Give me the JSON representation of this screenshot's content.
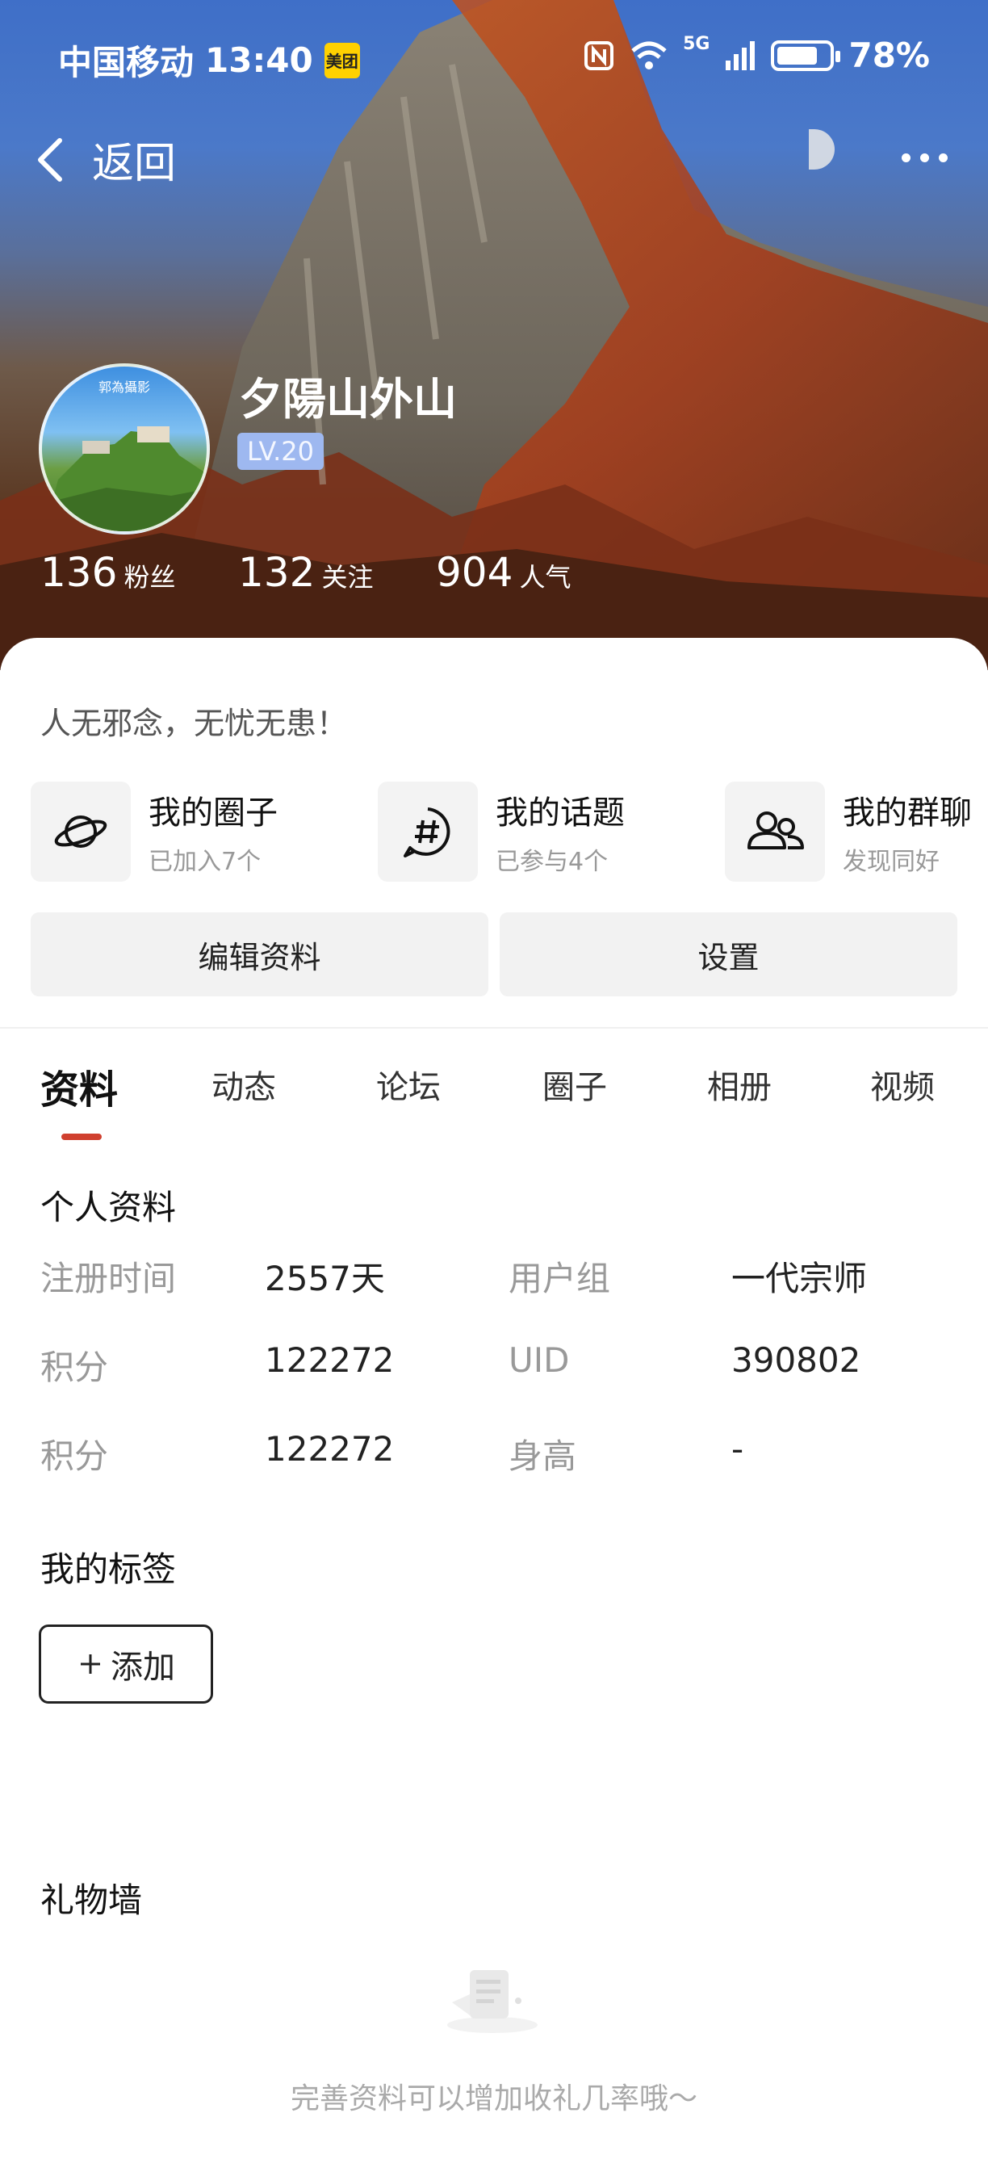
{
  "status_bar": {
    "carrier": "中国移动",
    "time": "13:40",
    "app_badge": "美团",
    "network": "5G",
    "battery": "78%"
  },
  "nav": {
    "back_label": "返回"
  },
  "profile": {
    "avatar_caption": "郭為攝影",
    "username": "夕陽山外山",
    "level": "LV.20",
    "stats": [
      {
        "num": "136",
        "label": "粉丝"
      },
      {
        "num": "132",
        "label": "关注"
      },
      {
        "num": "904",
        "label": "人气"
      }
    ],
    "signature": "人无邪念，无忧无患！"
  },
  "shortcuts": [
    {
      "title": "我的圈子",
      "sub": "已加入7个",
      "icon": "planet-icon"
    },
    {
      "title": "我的话题",
      "sub": "已参与4个",
      "icon": "hashtag-bubble-icon"
    },
    {
      "title": "我的群聊",
      "sub": "发现同好",
      "icon": "group-icon"
    }
  ],
  "buttons": {
    "edit": "编辑资料",
    "settings": "设置"
  },
  "tabs": [
    "资料",
    "动态",
    "论坛",
    "圈子",
    "相册",
    "视频"
  ],
  "active_tab": "资料",
  "personal_info": {
    "title": "个人资料",
    "rows": [
      {
        "k1": "注册时间",
        "v1": "2557天",
        "k2": "用户组",
        "v2": "一代宗师"
      },
      {
        "k1": "积分",
        "v1": "122272",
        "k2": "UID",
        "v2": "390802"
      },
      {
        "k1": "积分",
        "v1": "122272",
        "k2": "身高",
        "v2": "-"
      }
    ]
  },
  "tags": {
    "title": "我的标签",
    "add_label": "添加"
  },
  "gift_wall": {
    "title": "礼物墙",
    "empty_text": "完善资料可以增加收礼几率哦～"
  }
}
